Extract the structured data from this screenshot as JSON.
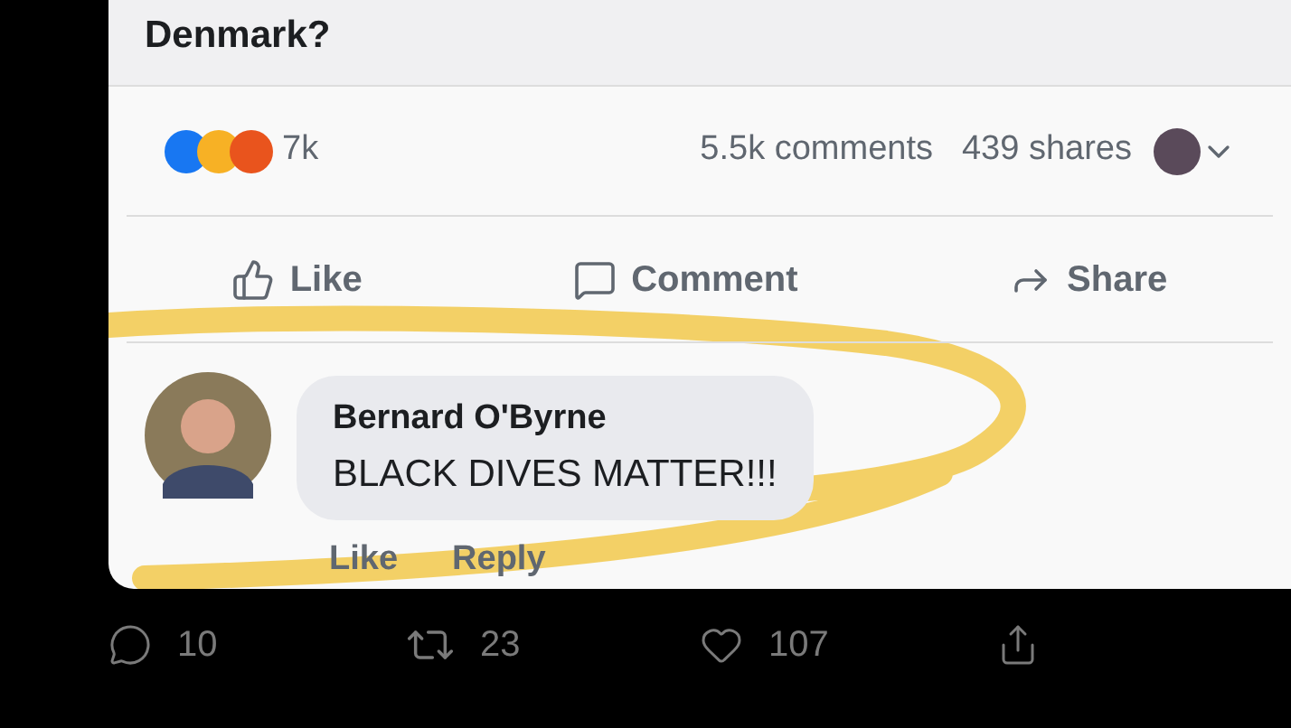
{
  "post": {
    "question": "Denmark?"
  },
  "stats": {
    "reactions": "7k",
    "comments": "5.5k comments",
    "shares": "439 shares"
  },
  "actions": [
    {
      "kind": "like",
      "label": "Like"
    },
    {
      "kind": "comment",
      "label": "Comment"
    },
    {
      "kind": "share",
      "label": "Share"
    }
  ],
  "comment": {
    "author": "Bernard O'Byrne",
    "text": "BLACK DIVES MATTER!!!",
    "links": [
      "Like",
      "Reply"
    ]
  },
  "tweet_actions": [
    {
      "kind": "reply",
      "count": "10"
    },
    {
      "kind": "retweet",
      "count": "23"
    },
    {
      "kind": "like",
      "count": "107"
    },
    {
      "kind": "share"
    }
  ]
}
